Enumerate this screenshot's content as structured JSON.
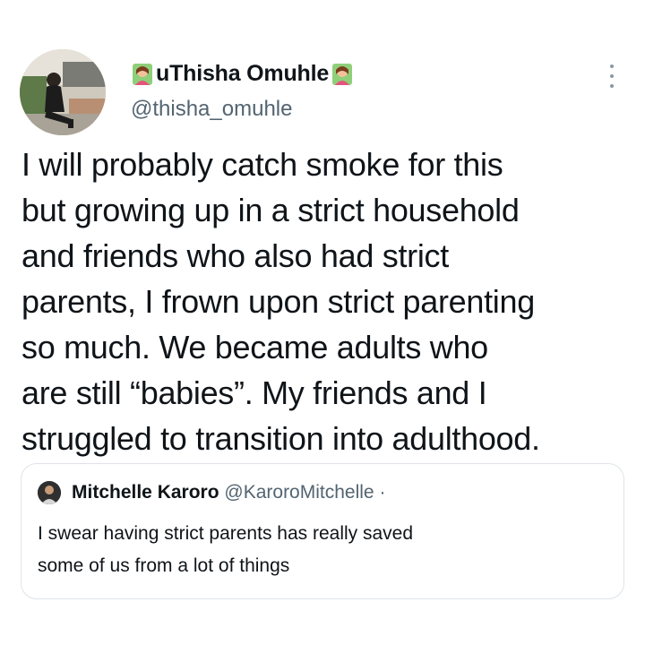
{
  "tweet": {
    "author_name": "uThisha Omuhle",
    "author_handle": "@thisha_omuhle",
    "author_emoji_icon": "woman-tipping-hand-icon",
    "text": "I will probably catch smoke for this\nbut growing up in a strict household\nand friends who also had strict\nparents, I frown upon strict parenting\nso much. We became adults who\nare still “babies”. My friends and I\nstruggled to transition into adulthood."
  },
  "quote": {
    "author_name": "Mitchelle Karoro",
    "author_handle": "@KaroroMitchelle",
    "separator": "·",
    "text": "I swear having strict parents has really saved\nsome of us from a lot of things"
  },
  "colors": {
    "text_primary": "#0f1419",
    "text_secondary": "#536471",
    "border": "#dfe4e8"
  }
}
